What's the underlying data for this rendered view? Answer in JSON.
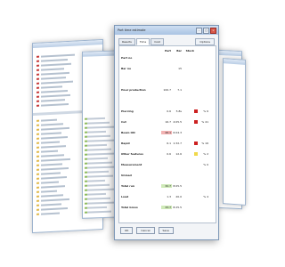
{
  "colors": {
    "accent": "#2e6fcf",
    "red": "#cc2020",
    "green": "#7fc24c",
    "yellow": "#f0d84a"
  },
  "dialog": {
    "title": "Part time estimate",
    "title_buttons": {
      "min": "–",
      "max": "□",
      "close": "×"
    },
    "tabs": [
      "Results",
      "Time",
      "Cost"
    ],
    "active_tab": 1,
    "options_label": "Options",
    "columns": [
      "",
      "Part",
      "Bar",
      "Stock",
      ""
    ],
    "rows": [
      {
        "label": "Part no",
        "part": "",
        "bar": "",
        "stock": "",
        "pct": ""
      },
      {
        "label": "Bar no",
        "part": "",
        "bar": "15",
        "stock": "",
        "pct": ""
      },
      {
        "label": "",
        "part": "",
        "bar": "",
        "stock": "",
        "pct": ""
      },
      {
        "label": "Hour production",
        "part": "100.7",
        "bar": "7.1",
        "stock": "",
        "pct": ""
      },
      {
        "label": "",
        "part": "",
        "bar": "",
        "stock": "",
        "pct": ""
      },
      {
        "label": "Piercing",
        "part": "0.6",
        "bar": "5.8s",
        "stock": "",
        "pct": "% 6",
        "swatch": "red"
      },
      {
        "label": "Cut",
        "part": "16.7",
        "bar": "4:05.5",
        "stock": "",
        "pct": "% 41",
        "swatch": "red"
      },
      {
        "label": "Beam ON",
        "part": "26.1",
        "bar": "6:04.3",
        "stock": "",
        "pct": "",
        "highlight": "red"
      },
      {
        "label": "Rapid",
        "part": "6.1",
        "bar": "1:32.7",
        "stock": "",
        "pct": "% 16",
        "swatch": "red"
      },
      {
        "label": "Other features",
        "part": "0.6",
        "bar": "12.6",
        "stock": "",
        "pct": "% 2",
        "swatch": "yellow"
      },
      {
        "label": "Measurement",
        "part": "",
        "bar": "",
        "stock": "",
        "pct": "% 0"
      },
      {
        "label": "Unload",
        "part": "",
        "bar": "",
        "stock": "",
        "pct": ""
      },
      {
        "label": "Total run",
        "part": "32.7",
        "bar": "8:05.5",
        "stock": "",
        "pct": "",
        "highlight": "green"
      },
      {
        "label": "Load",
        "part": "1.3",
        "bar": "20.0",
        "stock": "",
        "pct": "% 4"
      },
      {
        "label": "Total Gross",
        "part": "33.7",
        "bar": "8:25.5",
        "stock": "",
        "pct": "",
        "highlight": "green"
      }
    ],
    "buttons": {
      "ok": "OK",
      "cancel": "Cancel",
      "save": "Save"
    }
  }
}
